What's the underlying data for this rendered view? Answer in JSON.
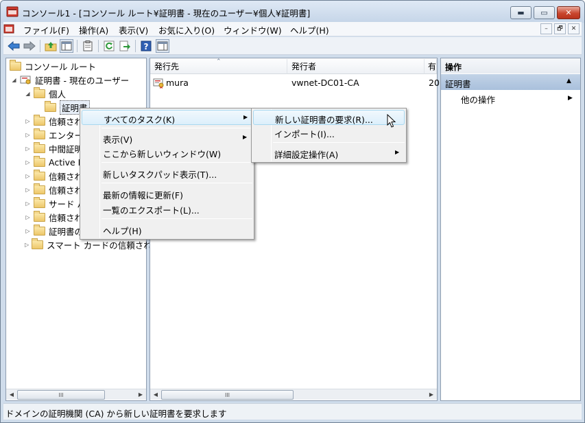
{
  "window": {
    "title": "コンソール1 - [コンソール ルート¥証明書 - 現在のユーザー¥個人¥証明書]",
    "min_label": "▬",
    "max_label": "▭",
    "close_label": "✕"
  },
  "menubar": {
    "items": [
      "ファイル(F)",
      "操作(A)",
      "表示(V)",
      "お気に入り(O)",
      "ウィンドウ(W)",
      "ヘルプ(H)"
    ],
    "mdi_min": "–",
    "mdi_restore": "🗗",
    "mdi_close": "✕"
  },
  "toolbar": {
    "icons": [
      "back-arrow-icon",
      "forward-arrow-icon",
      "up-folder-icon",
      "show-hide-tree-icon",
      "properties-icon",
      "refresh-icon",
      "export-list-icon",
      "help-icon",
      "show-hide-action-pane-icon"
    ]
  },
  "tree": {
    "root": "コンソール ルート",
    "store": "証明書 - 現在のユーザー",
    "personal": "個人",
    "certificates": "証明書",
    "children": [
      "信頼され",
      "エンター",
      "中間証明",
      "Active D",
      "信頼され",
      "信頼され",
      "サード パ",
      "信頼され",
      "証明書の",
      "スマート カードの信頼され"
    ]
  },
  "list": {
    "headers": [
      "発行先",
      "発行者",
      "有"
    ],
    "rows": [
      {
        "issued_to": "mura",
        "issued_by": "vwnet-DC01-CA",
        "expires": "20"
      }
    ]
  },
  "actions": {
    "header": "操作",
    "section": "証明書",
    "other": "他の操作"
  },
  "context_menu": {
    "items": [
      {
        "label": "すべてのタスク(K)",
        "submenu": true
      },
      {
        "label": "表示(V)",
        "submenu": true
      },
      {
        "label": "ここから新しいウィンドウ(W)",
        "submenu": false
      },
      {
        "label": "新しいタスクパッド表示(T)...",
        "submenu": false
      },
      {
        "label": "最新の情報に更新(F)",
        "submenu": false
      },
      {
        "label": "一覧のエクスポート(L)...",
        "submenu": false
      },
      {
        "label": "ヘルプ(H)",
        "submenu": false
      }
    ]
  },
  "submenu": {
    "items": [
      {
        "label": "新しい証明書の要求(R)...",
        "submenu": false
      },
      {
        "label": "インポート(I)...",
        "submenu": false
      },
      {
        "label": "詳細設定操作(A)",
        "submenu": true
      }
    ]
  },
  "statusbar": {
    "text": "ドメインの証明機関 (CA) から新しい証明書を要求します"
  },
  "scroll": {
    "thumb_grip": "III",
    "left_arrow": "◀",
    "right_arrow": "▶"
  }
}
